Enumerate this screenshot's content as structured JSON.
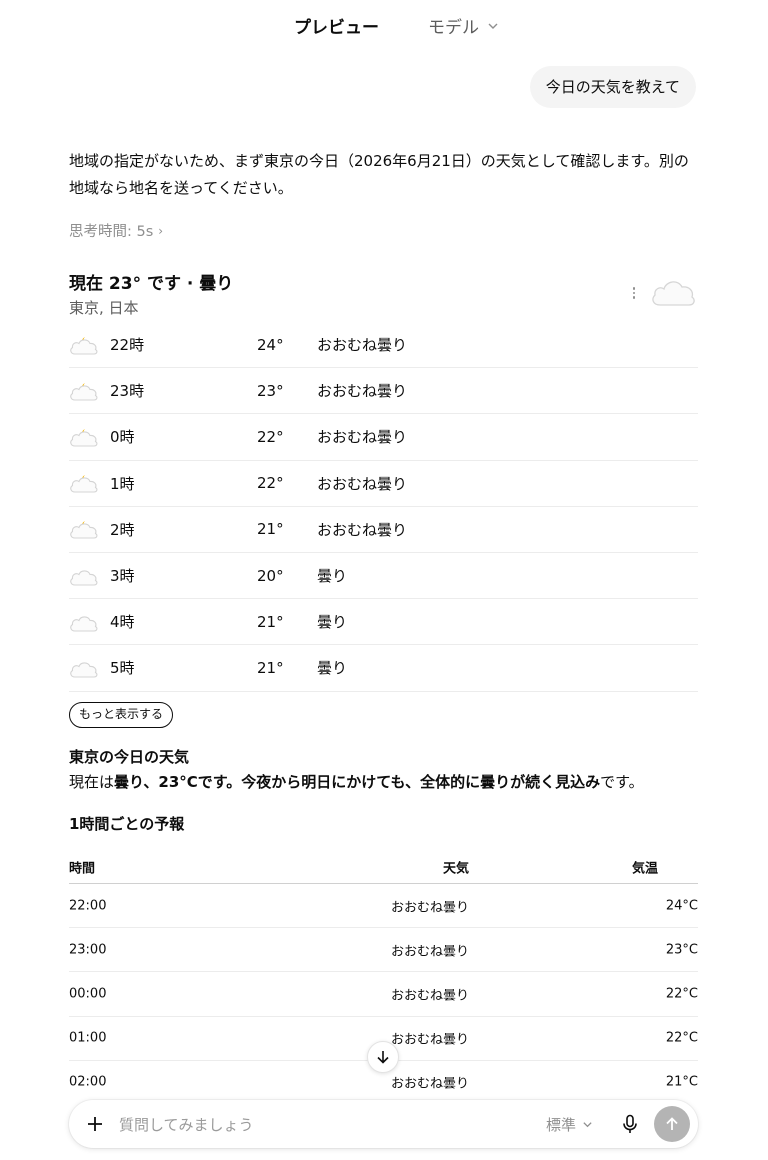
{
  "header": {
    "tab_preview": "プレビュー",
    "tab_model": "モデル"
  },
  "user_message": "今日の天気を教えて",
  "assistant": {
    "intro": "地域の指定がないため、まず東京の今日（2026年6月21日）の天気として確認します。別の地域なら地名を送ってください。",
    "thinking": "思考時間: 5s"
  },
  "weather": {
    "title": "現在 23° です · 曇り",
    "location": "東京, 日本",
    "hourly": [
      {
        "hour": "22時",
        "temp": "24°",
        "cond": "おおむね曇り",
        "icon": "partly-cloudy-night-icon"
      },
      {
        "hour": "23時",
        "temp": "23°",
        "cond": "おおむね曇り",
        "icon": "partly-cloudy-night-icon"
      },
      {
        "hour": "0時",
        "temp": "22°",
        "cond": "おおむね曇り",
        "icon": "partly-cloudy-night-icon"
      },
      {
        "hour": "1時",
        "temp": "22°",
        "cond": "おおむね曇り",
        "icon": "partly-cloudy-night-icon"
      },
      {
        "hour": "2時",
        "temp": "21°",
        "cond": "おおむね曇り",
        "icon": "partly-cloudy-night-icon"
      },
      {
        "hour": "3時",
        "temp": "20°",
        "cond": "曇り",
        "icon": "cloud-icon"
      },
      {
        "hour": "4時",
        "temp": "21°",
        "cond": "曇り",
        "icon": "cloud-icon"
      },
      {
        "hour": "5時",
        "temp": "21°",
        "cond": "曇り",
        "icon": "cloud-icon"
      }
    ],
    "show_more": "もっと表示する"
  },
  "summary": {
    "heading": "東京の今日の天気",
    "p_prefix": "現在は",
    "p_bold1": "曇り、23°Cです。今夜から明日にかけても、全体的に曇りが続く見込み",
    "p_suffix": "です。",
    "forecast_heading": "1時間ごとの予報"
  },
  "table": {
    "headers": [
      "時間",
      "天気",
      "気温"
    ],
    "rows": [
      [
        "22:00",
        "おおむね曇り",
        "24°C"
      ],
      [
        "23:00",
        "おおむね曇り",
        "23°C"
      ],
      [
        "00:00",
        "おおむね曇り",
        "22°C"
      ],
      [
        "01:00",
        "おおむね曇り",
        "22°C"
      ],
      [
        "02:00",
        "おおむね曇り",
        "21°C"
      ]
    ]
  },
  "composer": {
    "placeholder": "質問してみましょう",
    "mode": "標準"
  },
  "colors": {
    "accent_sun": "#f4b400",
    "bubble_bg": "#f4f4f4",
    "send_bg": "#b4b4b4"
  }
}
